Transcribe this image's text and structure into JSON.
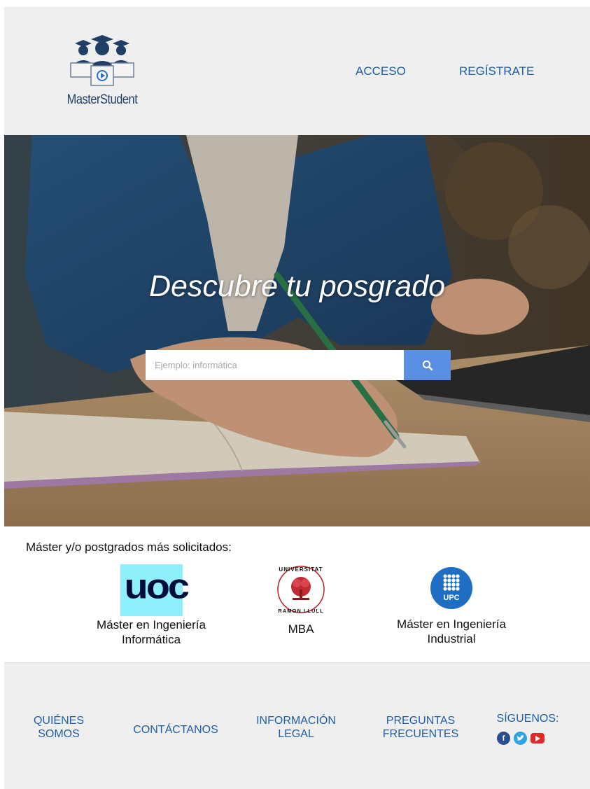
{
  "header": {
    "logo_text": "MasterStudent",
    "nav": {
      "acceso": "ACCESO",
      "registrate": "REGÍSTRATE"
    }
  },
  "hero": {
    "title": "Descubre tu posgrado",
    "search_placeholder": "Ejemplo: informática",
    "search_icon": "search-icon"
  },
  "popular": {
    "title": "Máster y/o postgrados más solicitados:",
    "items": [
      {
        "logo_text": "UOC",
        "label_line1": "Máster en Ingeniería",
        "label_line2": "Informática"
      },
      {
        "logo_text": "UNIVERSITAT RAMON LLULL",
        "label_line1": "MBA",
        "label_line2": ""
      },
      {
        "logo_text": "UPC",
        "label_line1": "Máster en Ingeniería",
        "label_line2": "Industrial"
      }
    ]
  },
  "footer": {
    "quienes_1": "QUIÉNES",
    "quienes_2": "SOMOS",
    "contactanos": "CONTÁCTANOS",
    "info_1": "INFORMACIÓN",
    "info_2": "LEGAL",
    "preg_1": "PREGUNTAS",
    "preg_2": "FRECUENTES",
    "siguenos": "SÍGUENOS:",
    "social": [
      "facebook-icon",
      "twitter-icon",
      "youtube-icon"
    ]
  },
  "colors": {
    "link": "#1e5fa8",
    "search_button": "#5b8fe6",
    "header_bg": "#efefef",
    "uoc_bg": "#8ff0fb",
    "upc_blue": "#1e6fc4"
  }
}
